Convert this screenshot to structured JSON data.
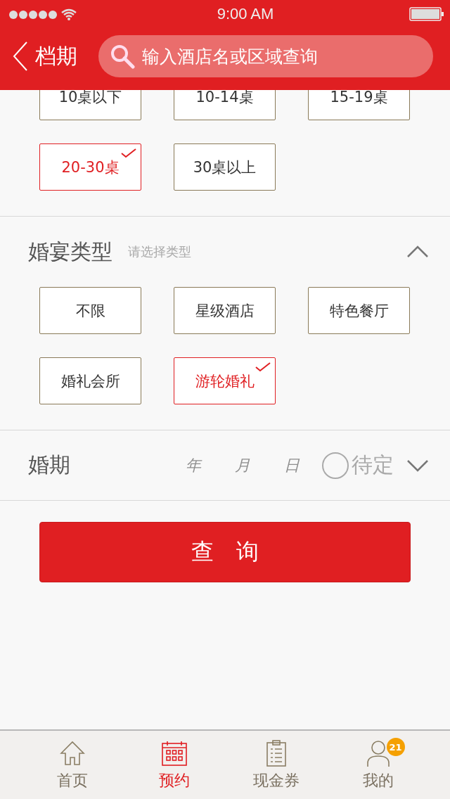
{
  "status_bar": {
    "time": "9:00 AM"
  },
  "nav": {
    "title": "档期",
    "search": {
      "placeholder": "输入酒店名或区域查询"
    }
  },
  "table_count": {
    "options": [
      {
        "label": "10桌以下",
        "selected": false
      },
      {
        "label": "10-14桌",
        "selected": false
      },
      {
        "label": "15-19桌",
        "selected": false
      },
      {
        "label": "20-30桌",
        "selected": true
      },
      {
        "label": "30桌以上",
        "selected": false
      }
    ]
  },
  "wedding_type": {
    "title": "婚宴类型",
    "hint": "请选择类型",
    "expanded": true,
    "options": [
      {
        "label": "不限",
        "selected": false
      },
      {
        "label": "星级酒店",
        "selected": false
      },
      {
        "label": "特色餐厅",
        "selected": false
      },
      {
        "label": "婚礼会所",
        "selected": false
      },
      {
        "label": "游轮婚礼",
        "selected": true
      }
    ]
  },
  "wedding_date": {
    "title": "婚期",
    "year": {
      "placeholder": "年"
    },
    "month": {
      "placeholder": "月"
    },
    "day": {
      "placeholder": "日"
    },
    "undecided": {
      "label": "待定",
      "checked": false
    },
    "expanded": false
  },
  "query_button": {
    "label": "查　询"
  },
  "tab_bar": [
    {
      "kind": "home",
      "label": "首页",
      "selected": false
    },
    {
      "kind": "calendar",
      "label": "预约",
      "selected": true
    },
    {
      "kind": "clipboard",
      "label": "现金券",
      "selected": false
    },
    {
      "kind": "person",
      "label": "我的",
      "selected": false,
      "badge": "21"
    }
  ]
}
